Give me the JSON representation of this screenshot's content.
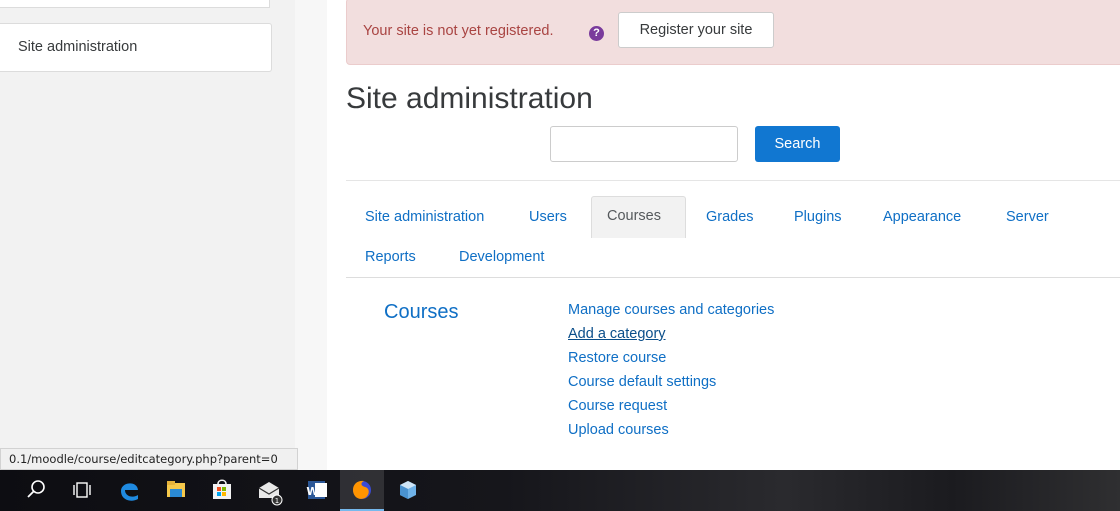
{
  "sidebar": {
    "item_label": "Site administration"
  },
  "alert": {
    "message": "Your site is not yet registered.",
    "help_icon": "question-circle-icon",
    "register_button": "Register your site"
  },
  "page": {
    "title": "Site administration"
  },
  "search": {
    "placeholder": "",
    "value": "",
    "button_label": "Search"
  },
  "tabs": [
    {
      "label": "Site administration",
      "active": false
    },
    {
      "label": "Users",
      "active": false
    },
    {
      "label": "Courses",
      "active": true
    },
    {
      "label": "Grades",
      "active": false
    },
    {
      "label": "Plugins",
      "active": false
    },
    {
      "label": "Appearance",
      "active": false
    },
    {
      "label": "Server",
      "active": false
    },
    {
      "label": "Reports",
      "active": false
    },
    {
      "label": "Development",
      "active": false
    }
  ],
  "section": {
    "title": "Courses",
    "links": [
      "Manage courses and categories",
      "Add a category",
      "Restore course",
      "Course default settings",
      "Course request",
      "Upload courses"
    ]
  },
  "statusbar": {
    "url": "0.1/moodle/course/editcategory.php?parent=0"
  },
  "taskbar": {
    "icons": [
      "search-icon",
      "task-view-icon",
      "edge-icon",
      "file-explorer-icon",
      "store-icon",
      "mail-icon",
      "word-icon",
      "firefox-icon",
      "app-cube-icon"
    ],
    "mail_badge": "1"
  },
  "colors": {
    "link": "#0f6fc5",
    "primary_button": "#1177d1",
    "alert_bg": "#f2dede",
    "alert_text": "#a94442"
  }
}
